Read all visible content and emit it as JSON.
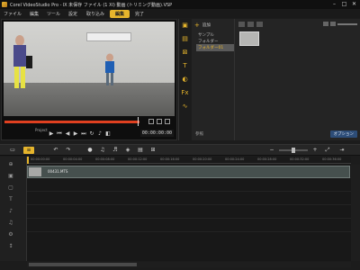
{
  "window": {
    "title": "Corel VideoStudio Pro - Ⅸ 未保存 ファイル (1 ⅩⅠ)  動画 (トリミング動画).VSP"
  },
  "menu": [
    "ファイル",
    "編集",
    "ツール",
    "設定"
  ],
  "steps": [
    "取り込み",
    "編集",
    "完了"
  ],
  "player": {
    "mode_label": "Project",
    "timecode": "00:00:00:00"
  },
  "library": {
    "add_label": "追加",
    "folders": [
      "サンプル",
      "フォルダー",
      "フォルダー01"
    ],
    "selected_folder_index": 2,
    "thumbnail_label": "",
    "options_label": "オプション",
    "browse_label": "参照"
  },
  "timeline": {
    "ruler_ticks": [
      "00:00:00:00",
      "00:00:04:00",
      "00:00:08:00",
      "00:00:12:00",
      "00:00:16:00",
      "00:00:20:00",
      "00:00:24:00",
      "00:00:28:00",
      "00:00:32:00",
      "00:00:36:00"
    ],
    "clip_label": "00431.MTS"
  },
  "icons": [
    "app-icon",
    "minimize-icon",
    "maximize-icon",
    "close-icon",
    "play-icon",
    "scissors-icon",
    "undo-icon",
    "redo-icon",
    "zoom-icon"
  ],
  "colors": {
    "accent": "#e6b52c",
    "scrub": "#e04020",
    "options": "#2d4d78"
  }
}
